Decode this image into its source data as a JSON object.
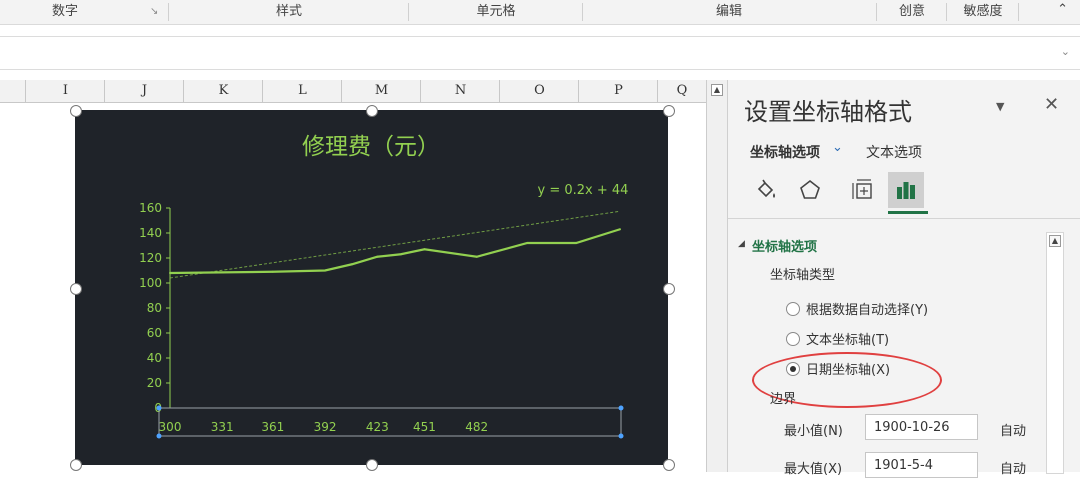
{
  "ribbon": {
    "groups": [
      "数字",
      "样式",
      "单元格",
      "编辑",
      "创意",
      "敏感度"
    ],
    "launcher_icon": "dialog-launcher-icon",
    "collapse_icon": "chevron-up-icon"
  },
  "formula_bar": {
    "dropdown_icon": "chevron-down-icon"
  },
  "columns": [
    "I",
    "J",
    "K",
    "L",
    "M",
    "N",
    "O",
    "P",
    "Q"
  ],
  "chart": {
    "trendline_label": "y = 0.2x + 44",
    "background": "#1f2329",
    "title_color": "#92d050",
    "line_color": "#92d050"
  },
  "chart_data": {
    "type": "line",
    "title": "修理费（元）",
    "x": [
      300,
      331,
      361,
      392,
      408,
      423,
      437,
      451,
      482,
      512,
      541,
      567
    ],
    "x_tick_labels": [
      "300",
      "331",
      "361",
      "392",
      "423",
      "451",
      "482"
    ],
    "series": [
      {
        "values": [
          108,
          108.5,
          109,
          110,
          115,
          121,
          123,
          127,
          121,
          132,
          132,
          143
        ]
      }
    ],
    "trendline": {
      "slope": 0.2,
      "intercept": 44,
      "label": "y = 0.2x + 44"
    },
    "ylim": [
      0,
      160
    ],
    "y_ticks": [
      0,
      20,
      40,
      60,
      80,
      100,
      120,
      140,
      160
    ],
    "xlabel": "",
    "ylabel": "",
    "grid": false,
    "legend": "none"
  },
  "pane": {
    "title": "设置坐标轴格式",
    "dropdown_icon": "triangle-down-icon",
    "close_icon": "close-icon",
    "tab_axis_options": "坐标轴选项",
    "tab_text_options": "文本选项",
    "icons": [
      "fill-line-icon",
      "effects-pentagon-icon",
      "size-properties-icon",
      "axis-options-bar-chart-icon"
    ],
    "section_title": "坐标轴选项",
    "axis_type_label": "坐标轴类型",
    "radio_auto": "根据数据自动选择(Y)",
    "radio_text": "文本坐标轴(T)",
    "radio_date": "日期坐标轴(X)",
    "selected_radio": "日期坐标轴(X)",
    "bounds_label": "边界",
    "min_label": "最小值(N)",
    "min_value": "1900-10-26",
    "max_label": "最大值(X)",
    "max_value": "1901-5-4",
    "auto_label": "自动",
    "annotation_color": "#e04040"
  }
}
